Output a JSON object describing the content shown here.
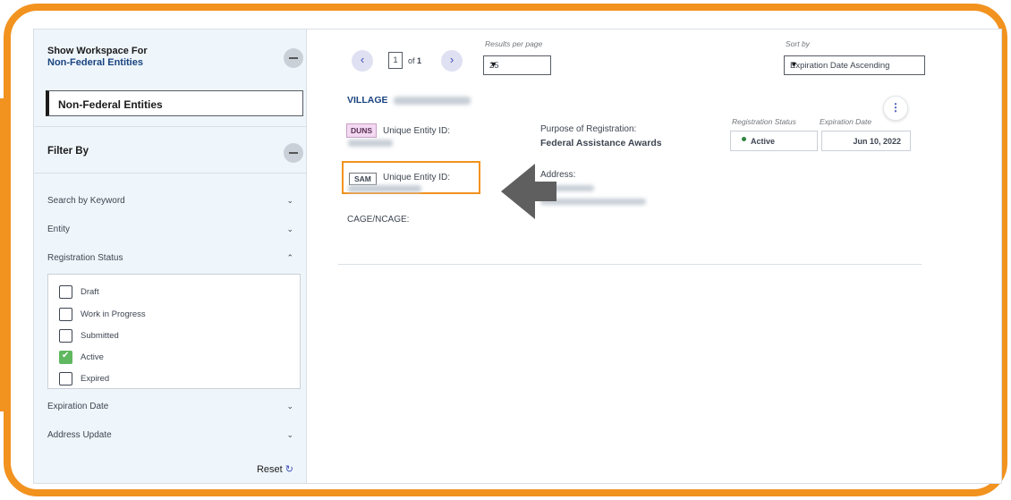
{
  "sidebar": {
    "workspace_title": "Show Workspace For",
    "workspace_value": "Non-Federal Entities",
    "workspace_selected": "Non-Federal Entities",
    "filter_title": "Filter By",
    "accordions": {
      "keyword": "Search by Keyword",
      "entity": "Entity",
      "registration_status": "Registration Status",
      "expiration_date": "Expiration Date",
      "address_update": "Address Update"
    },
    "status_options": [
      {
        "label": "Draft",
        "checked": false
      },
      {
        "label": "Work in Progress",
        "checked": false
      },
      {
        "label": "Submitted",
        "checked": false
      },
      {
        "label": "Active",
        "checked": true
      },
      {
        "label": "Expired",
        "checked": false
      }
    ],
    "reset_label": "Reset"
  },
  "pagination": {
    "current_page": "1",
    "of_label": "of",
    "total_pages": "1",
    "prev_icon": "chevron-left-icon",
    "next_icon": "chevron-right-icon"
  },
  "results_per_page": {
    "label": "Results per page",
    "value": "25"
  },
  "sort": {
    "label": "Sort by",
    "value": "Expiration Date Ascending"
  },
  "record": {
    "name": "VILLAGE",
    "duns_badge": "DUNS",
    "sam_badge": "SAM",
    "unique_entity_label": "Unique Entity ID:",
    "cage_label": "CAGE/NCAGE:",
    "purpose_label": "Purpose of Registration:",
    "purpose_value": "Federal Assistance Awards",
    "address_label": "Address:",
    "registration_status_label": "Registration Status",
    "registration_status_value": "Active",
    "expiration_date_label": "Expiration Date",
    "expiration_date_value": "Jun 10, 2022"
  },
  "colors": {
    "frame": "#f2921f",
    "accent": "#1a4480",
    "active_dot": "#2e8540",
    "checkbox_checked": "#5fb85f"
  }
}
